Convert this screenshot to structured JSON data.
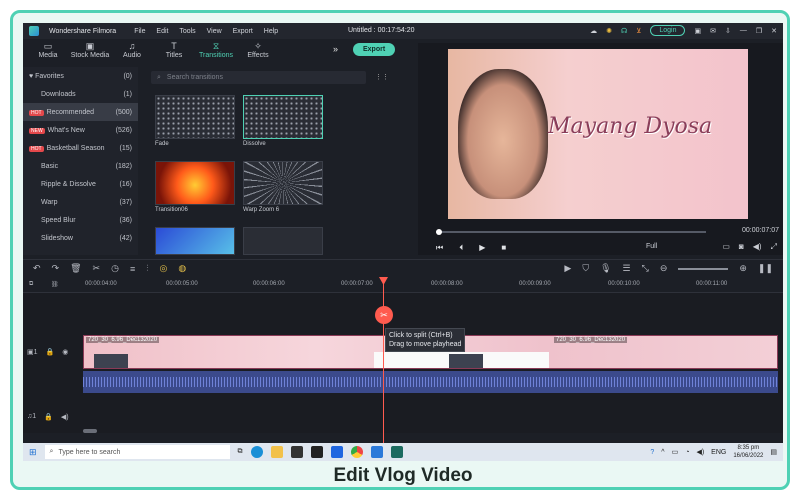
{
  "app": {
    "name": "Wondershare Filmora",
    "window_title": "Untitled : 00:17:54:20",
    "menu": [
      "File",
      "Edit",
      "Tools",
      "View",
      "Export",
      "Help"
    ],
    "login_label": "Login"
  },
  "toolbar": {
    "tabs": [
      {
        "label": "Media",
        "icon": "folder-icon"
      },
      {
        "label": "Stock Media",
        "icon": "stock-icon"
      },
      {
        "label": "Audio",
        "icon": "music-icon"
      },
      {
        "label": "Titles",
        "icon": "text-icon"
      },
      {
        "label": "Transitions",
        "icon": "transition-icon"
      },
      {
        "label": "Effects",
        "icon": "effects-icon"
      }
    ],
    "export_label": "Export"
  },
  "sidebar": {
    "items": [
      {
        "label": "Favorites",
        "count": "(0)"
      },
      {
        "label": "Downloads",
        "count": "(1)"
      },
      {
        "label": "Recommended",
        "count": "(500)",
        "badge": "HOT"
      },
      {
        "label": "What's New",
        "count": "(526)",
        "badge": "NEW"
      },
      {
        "label": "Basketball Season",
        "count": "(15)",
        "badge": "HOT"
      },
      {
        "label": "Basic",
        "count": "(182)"
      },
      {
        "label": "Ripple & Dissolve",
        "count": "(16)"
      },
      {
        "label": "Warp",
        "count": "(37)"
      },
      {
        "label": "Speed Blur",
        "count": "(36)"
      },
      {
        "label": "Slideshow",
        "count": "(42)"
      }
    ]
  },
  "browser": {
    "search_placeholder": "Search transitions",
    "items": [
      "Fade",
      "Dissolve",
      "Transition06",
      "Warp Zoom 6"
    ]
  },
  "preview": {
    "banner_text": "Mayang Dyosa",
    "time": "00:00:07:07",
    "quality": "Full"
  },
  "timeline": {
    "ruler": [
      "00:00:04:00",
      "00:00:05:00",
      "00:00:06:00",
      "00:00:07:00",
      "00:00:08:00",
      "00:00:09:00",
      "00:00:10:00",
      "00:00:11:00"
    ],
    "tooltip_line1": "Click to split (Ctrl+B)",
    "tooltip_line2": "Drag to move playhead",
    "clip_name": "720_30_6.96_Dec132020"
  },
  "taskbar": {
    "search_placeholder": "Type here to search",
    "lang": "ENG",
    "time": "8:35 pm",
    "date": "16/06/2022"
  },
  "caption": "Edit Vlog Video"
}
